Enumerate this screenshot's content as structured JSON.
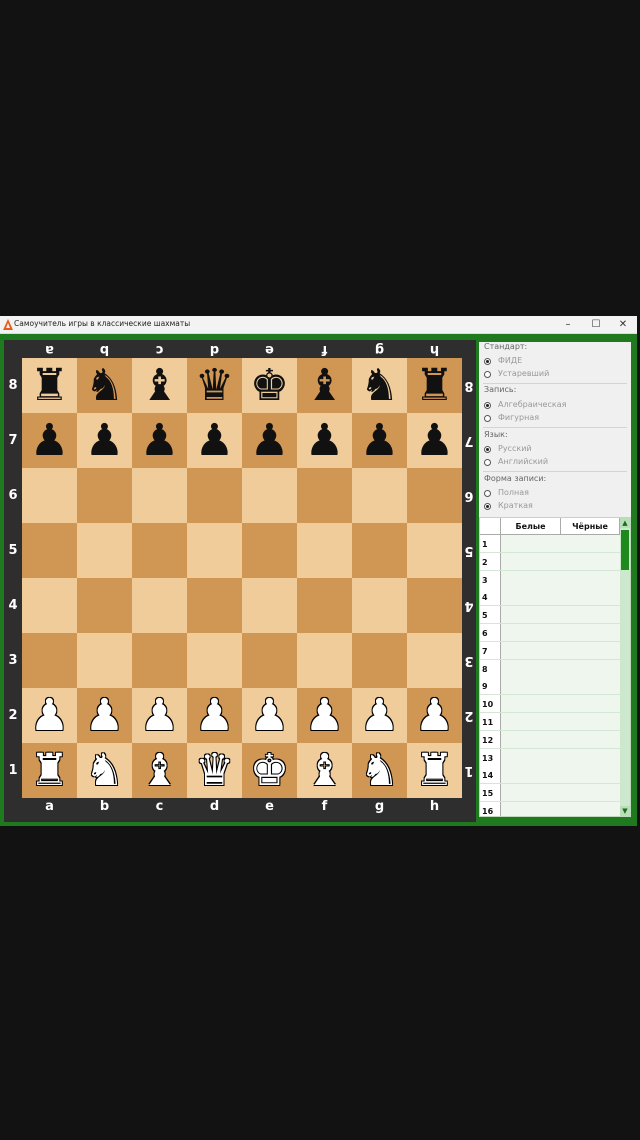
{
  "window": {
    "title": "Самоучитель игры в классические шахматы",
    "min_label": "–",
    "max_label": "☐",
    "close_label": "✕"
  },
  "board": {
    "files": [
      "a",
      "b",
      "c",
      "d",
      "e",
      "f",
      "g",
      "h"
    ],
    "ranks": [
      "8",
      "7",
      "6",
      "5",
      "4",
      "3",
      "2",
      "1"
    ],
    "position": [
      [
        "r",
        "n",
        "b",
        "q",
        "k",
        "b",
        "n",
        "r"
      ],
      [
        "p",
        "p",
        "p",
        "p",
        "p",
        "p",
        "p",
        "p"
      ],
      [
        "",
        "",
        "",
        "",
        "",
        "",
        "",
        ""
      ],
      [
        "",
        "",
        "",
        "",
        "",
        "",
        "",
        ""
      ],
      [
        "",
        "",
        "",
        "",
        "",
        "",
        "",
        ""
      ],
      [
        "",
        "",
        "",
        "",
        "",
        "",
        "",
        ""
      ],
      [
        "P",
        "P",
        "P",
        "P",
        "P",
        "P",
        "P",
        "P"
      ],
      [
        "R",
        "N",
        "B",
        "Q",
        "K",
        "B",
        "N",
        "R"
      ]
    ],
    "colors": {
      "light": "#f0cc9a",
      "dark": "#d09654",
      "frame": "#2e2e2e",
      "window_border": "#1f7a1f"
    }
  },
  "settings": {
    "standard": {
      "title": "Стандарт:",
      "options": [
        {
          "label": "ФИДЕ",
          "selected": true
        },
        {
          "label": "Устаревший",
          "selected": false
        }
      ]
    },
    "notation": {
      "title": "Запись:",
      "options": [
        {
          "label": "Алгебраическая",
          "selected": true
        },
        {
          "label": "Фигурная",
          "selected": false
        }
      ]
    },
    "language": {
      "title": "Язык:",
      "options": [
        {
          "label": "Русский",
          "selected": true
        },
        {
          "label": "Английский",
          "selected": false
        }
      ]
    },
    "form": {
      "title": "Форма записи:",
      "options": [
        {
          "label": "Полная",
          "selected": false
        },
        {
          "label": "Краткая",
          "selected": true
        }
      ]
    }
  },
  "moves": {
    "headers": {
      "white": "Белые",
      "black": "Чёрные"
    },
    "rows": [
      "1",
      "2",
      "3",
      "4",
      "5",
      "6",
      "7",
      "8",
      "9",
      "10",
      "11",
      "12",
      "13",
      "14",
      "15",
      "16"
    ]
  }
}
